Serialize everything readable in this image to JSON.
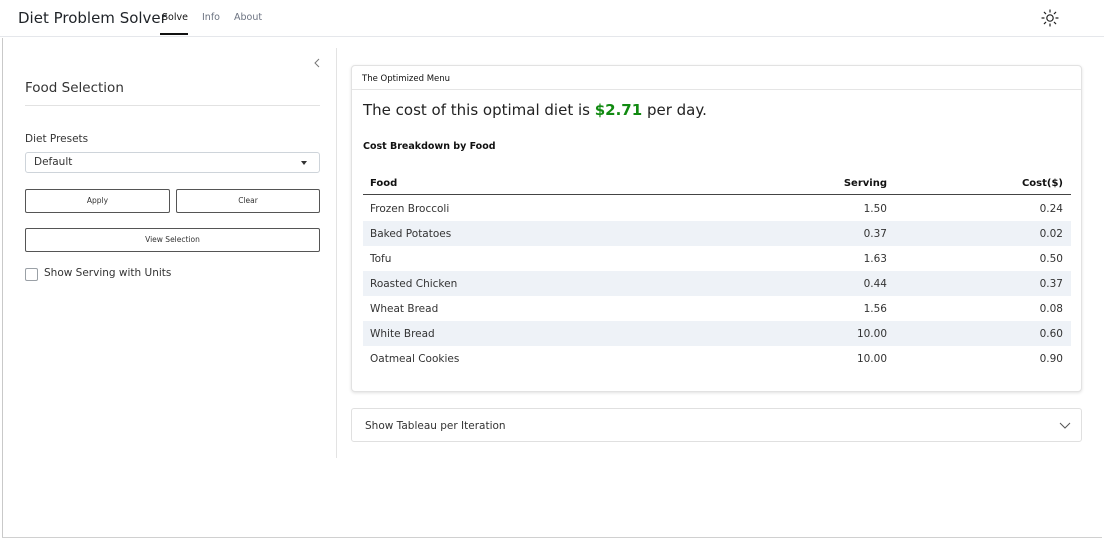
{
  "app": {
    "title": "Diet Problem Solver"
  },
  "nav": {
    "tabs": [
      "Solve",
      "Info",
      "About"
    ],
    "active": "Solve",
    "theme_icon": "sun-icon"
  },
  "sidebar": {
    "title": "Food Selection",
    "presets_label": "Diet Presets",
    "preset_selected": "Default",
    "apply_label": "Apply",
    "clear_label": "Clear",
    "view_selection_label": "View Selection",
    "show_units_label": "Show Serving with Units",
    "show_units_checked": false
  },
  "card": {
    "header": "The Optimized Menu",
    "cost_prefix": "The cost of this optimal diet is ",
    "cost_value": "$2.71",
    "cost_suffix": " per day.",
    "breakdown_title": "Cost Breakdown by Food",
    "columns": [
      "Food",
      "Serving",
      "Cost($)"
    ],
    "rows": [
      {
        "food": "Frozen Broccoli",
        "serving": "1.50",
        "cost": "0.24"
      },
      {
        "food": "Baked Potatoes",
        "serving": "0.37",
        "cost": "0.02"
      },
      {
        "food": "Tofu",
        "serving": "1.63",
        "cost": "0.50"
      },
      {
        "food": "Roasted Chicken",
        "serving": "0.44",
        "cost": "0.37"
      },
      {
        "food": "Wheat Bread",
        "serving": "1.56",
        "cost": "0.08"
      },
      {
        "food": "White Bread",
        "serving": "10.00",
        "cost": "0.60"
      },
      {
        "food": "Oatmeal Cookies",
        "serving": "10.00",
        "cost": "0.90"
      }
    ]
  },
  "accordion": {
    "label": "Show Tableau per Iteration",
    "expanded": false
  },
  "colors": {
    "cost_highlight": "#118a11",
    "row_stripe": "#eef2f7"
  }
}
